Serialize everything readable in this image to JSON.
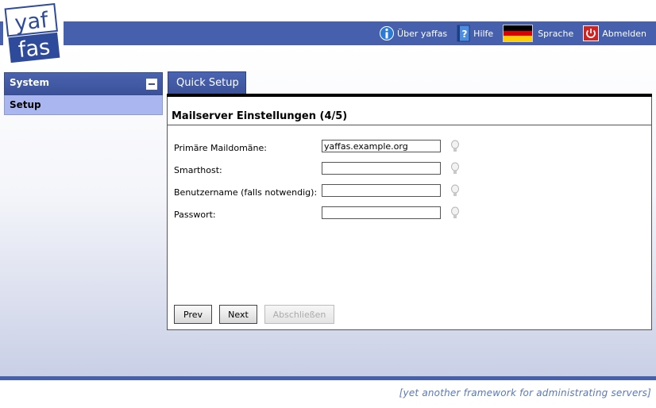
{
  "logo": {
    "line1": "yaf",
    "line2": "fas"
  },
  "top_nav": {
    "about": "Über yaffas",
    "help": "Hilfe",
    "language": "Sprache",
    "logout": "Abmelden"
  },
  "sidebar": {
    "section_title": "System",
    "items": [
      {
        "label": "Setup"
      }
    ]
  },
  "tab": {
    "label": "Quick Setup"
  },
  "panel": {
    "title": "Mailserver Einstellungen (4/5)",
    "fields": [
      {
        "label": "Primäre Maildomäne:",
        "value": "yaffas.example.org"
      },
      {
        "label": "Smarthost:",
        "value": ""
      },
      {
        "label": "Benutzername (falls notwendig):",
        "value": ""
      },
      {
        "label": "Passwort:",
        "value": ""
      }
    ],
    "buttons": {
      "prev": "Prev",
      "next": "Next",
      "finish": "Abschließen"
    }
  },
  "footer": {
    "tagline": "[yet another framework for administrating servers]"
  },
  "colors": {
    "brand_blue": "#4660ad",
    "menu_item_bg": "#a9b6f0",
    "tagline": "#5a78b8"
  }
}
